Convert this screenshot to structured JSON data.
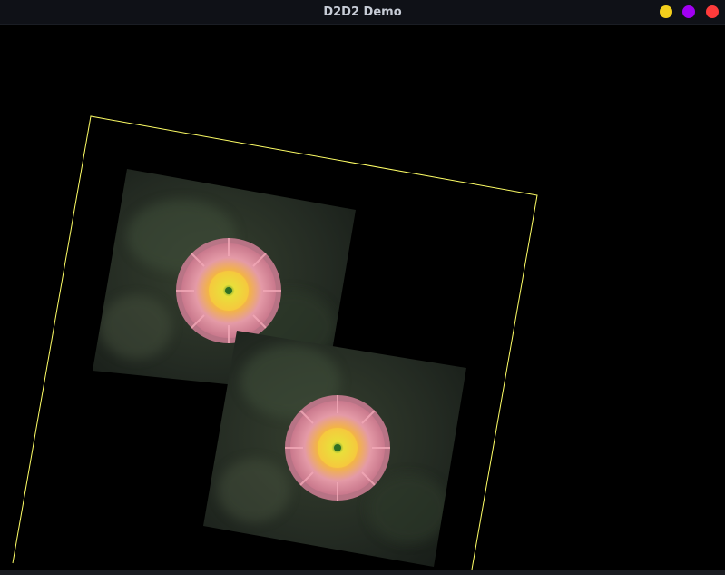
{
  "window": {
    "title": "D2D2 Demo",
    "buttons": {
      "minimize_color": "#f3cf1c",
      "maximize_color": "#a100f2",
      "close_color": "#ff3b3b"
    }
  },
  "scene": {
    "background_color": "#000000",
    "bounding_frame_color": "#ffff66",
    "sprites": [
      {
        "name": "flower-sprite-1",
        "icon": "pink-flower-photo"
      },
      {
        "name": "flower-sprite-2",
        "icon": "pink-flower-photo"
      }
    ]
  }
}
